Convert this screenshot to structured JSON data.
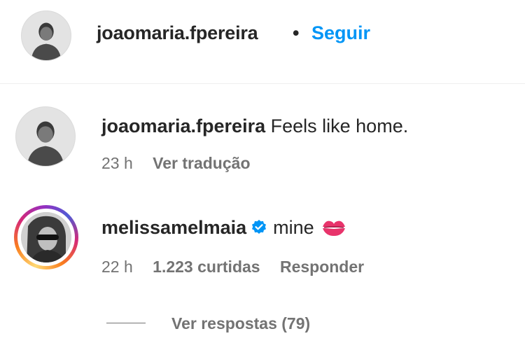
{
  "header": {
    "username": "joaomaria.fpereira",
    "separator": "•",
    "follow_label": "Seguir"
  },
  "comments": [
    {
      "username": "joaomaria.fpereira",
      "text": "Feels like home.",
      "time": "23 h",
      "translate_label": "Ver tradução"
    },
    {
      "username": "melissamelmaia",
      "verified": true,
      "text": "mine",
      "emoji": "kiss-mark-icon",
      "time": "22 h",
      "likes": "1.223 curtidas",
      "reply_label": "Responder",
      "view_replies_label": "Ver respostas (79)"
    }
  ],
  "colors": {
    "follow": "#0095f6",
    "verified": "#0095f6",
    "muted_text": "#737373",
    "primary_text": "#262626",
    "story_ring": [
      "#feda75",
      "#fa7e1e",
      "#d62976",
      "#962fbf",
      "#4f5bd5"
    ]
  }
}
